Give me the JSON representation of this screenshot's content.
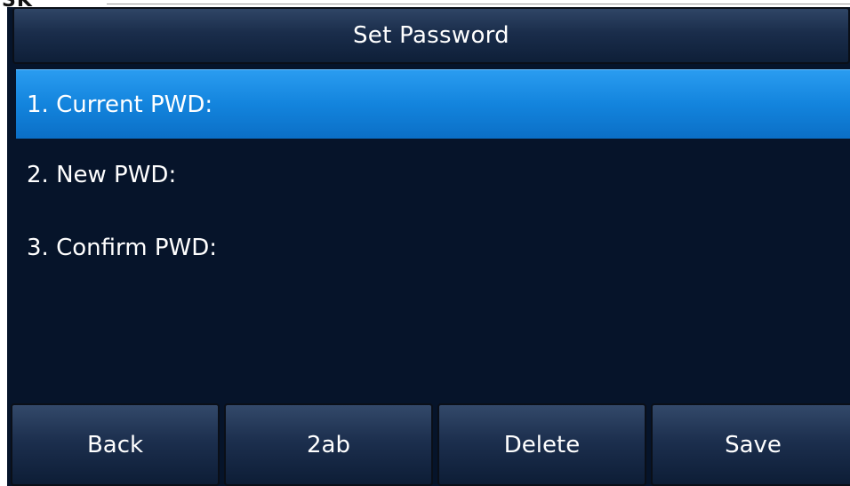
{
  "brand": {
    "text": "SK"
  },
  "header": {
    "title": "Set Password"
  },
  "menu": {
    "items": [
      {
        "label": "1. Current PWD:",
        "selected": true
      },
      {
        "label": "2. New PWD:",
        "selected": false
      },
      {
        "label": "3. Confirm PWD:",
        "selected": false
      }
    ]
  },
  "softkeys": [
    {
      "label": "Back"
    },
    {
      "label": "2ab"
    },
    {
      "label": "Delete"
    },
    {
      "label": "Save"
    }
  ],
  "colors": {
    "background": "#06142a",
    "selection": "#1384dd",
    "text": "#ffffff"
  }
}
